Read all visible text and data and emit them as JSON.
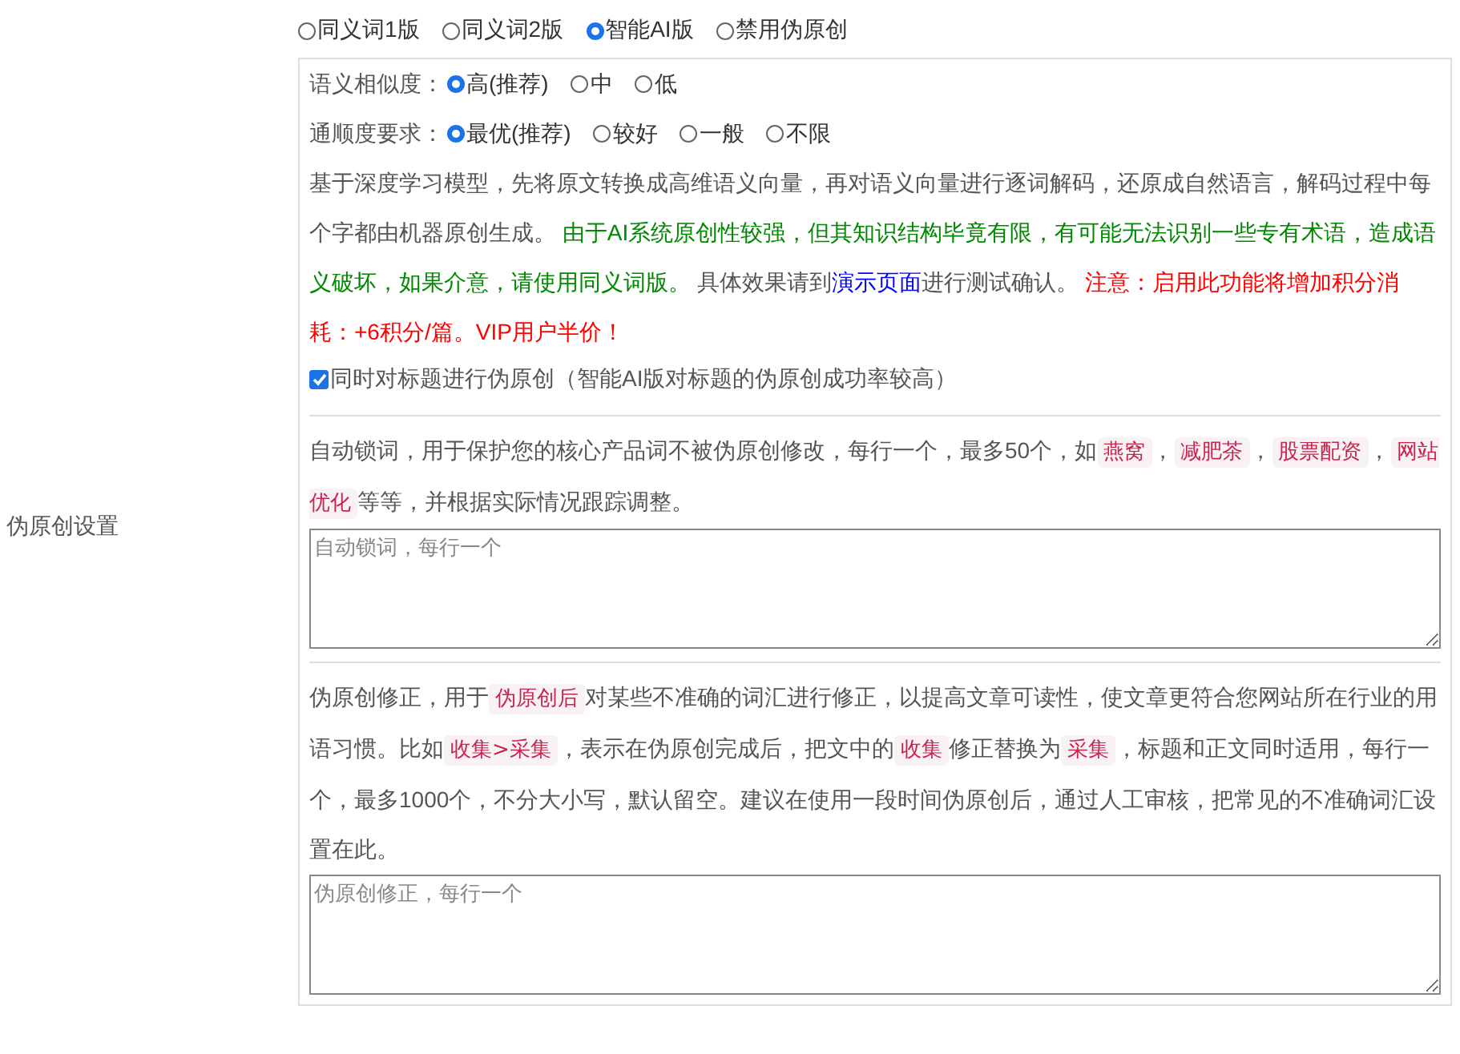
{
  "label": "伪原创设置",
  "modes": [
    {
      "label": "同义词1版",
      "selected": false
    },
    {
      "label": "同义词2版",
      "selected": false
    },
    {
      "label": "智能AI版",
      "selected": true
    },
    {
      "label": "禁用伪原创",
      "selected": false
    }
  ],
  "settings": [
    {
      "label": "语义相似度：",
      "options": [
        {
          "label": "高(推荐)",
          "selected": true
        },
        {
          "label": "中",
          "selected": false
        },
        {
          "label": "低",
          "selected": false
        }
      ]
    },
    {
      "label": "通顺度要求：",
      "options": [
        {
          "label": "最优(推荐)",
          "selected": true
        },
        {
          "label": "较好",
          "selected": false
        },
        {
          "label": "一般",
          "selected": false
        },
        {
          "label": "不限",
          "selected": false
        }
      ]
    }
  ],
  "description": [
    {
      "kind": "plain",
      "text": "基于深度学习模型，先将原文转换成高维语义向量，再对语义向量进行逐词解码，还原成自然语言，解码过程中每个字都由机器原创生成。 "
    },
    {
      "kind": "green",
      "text": "由于AI系统原创性较强，但其知识结构毕竟有限，有可能无法识别一些专有术语，造成语义破坏，如果介意，请使用同义词版。"
    },
    {
      "kind": "plain",
      "text": " 具体效果请到"
    },
    {
      "kind": "link",
      "text": "演示页面"
    },
    {
      "kind": "plain",
      "text": "进行测试确认。 "
    },
    {
      "kind": "red",
      "text": "注意：启用此功能将增加积分消耗：+6积分/篇。VIP用户半价！"
    }
  ],
  "title_option": {
    "label": "同时对标题进行伪原创（智能AI版对标题的伪原创成功率较高）",
    "checked": true
  },
  "sections": [
    {
      "description": [
        {
          "kind": "plain",
          "text": "自动锁词，用于保护您的核心产品词不被伪原创修改，每行一个，最多50个，如"
        },
        {
          "kind": "code",
          "text": "燕窝"
        },
        {
          "kind": "plain",
          "text": "，"
        },
        {
          "kind": "code",
          "text": "减肥茶"
        },
        {
          "kind": "plain",
          "text": "，"
        },
        {
          "kind": "code",
          "text": "股票配资"
        },
        {
          "kind": "plain",
          "text": "，"
        },
        {
          "kind": "code",
          "text": "网站优化"
        },
        {
          "kind": "plain",
          "text": "等等，并根据实际情况跟踪调整。"
        }
      ],
      "placeholder": "自动锁词，每行一个"
    },
    {
      "description": [
        {
          "kind": "plain",
          "text": "伪原创修正，用于"
        },
        {
          "kind": "code",
          "text": "伪原创后"
        },
        {
          "kind": "plain",
          "text": "对某些不准确的词汇进行修正，以提高文章可读性，使文章更符合您网站所在行业的用语习惯。比如"
        },
        {
          "kind": "code",
          "text": "收集>采集"
        },
        {
          "kind": "plain",
          "text": "，表示在伪原创完成后，把文中的"
        },
        {
          "kind": "code",
          "text": "收集"
        },
        {
          "kind": "plain",
          "text": "修正替换为"
        },
        {
          "kind": "code",
          "text": "采集"
        },
        {
          "kind": "plain",
          "text": "，标题和正文同时适用，每行一个，最多1000个，不分大小写，默认留空。建议在使用一段时间伪原创后，通过人工审核，把常见的不准确词汇设置在此。"
        }
      ],
      "placeholder": "伪原创修正，每行一个"
    }
  ]
}
